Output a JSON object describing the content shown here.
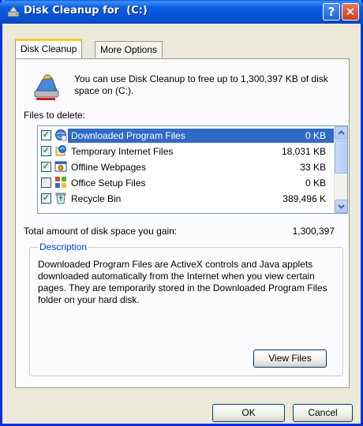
{
  "window": {
    "title": "Disk Cleanup for  (C:)",
    "help_glyph": "?",
    "close_glyph": "✕",
    "titlebar_color": "#0a5fe3"
  },
  "tabs": [
    {
      "label": "Disk Cleanup",
      "active": true
    },
    {
      "label": "More Options",
      "active": false
    }
  ],
  "intro": {
    "icon": "disk-cleanup-icon",
    "text": "You can use Disk Cleanup to free up to 1,300,397 KB of disk space on  (C:)."
  },
  "files_label": "Files to delete:",
  "files": [
    {
      "label": "Downloaded Program Files",
      "size": "0 KB",
      "checked": true,
      "selected": true,
      "icon": "globe-icon"
    },
    {
      "label": "Temporary Internet Files",
      "size": "18,031 KB",
      "checked": true,
      "selected": false,
      "icon": "internet-files-icon"
    },
    {
      "label": "Offline Webpages",
      "size": "33 KB",
      "checked": true,
      "selected": false,
      "icon": "offline-pages-icon"
    },
    {
      "label": "Office Setup Files",
      "size": "0 KB",
      "checked": false,
      "selected": false,
      "icon": "office-setup-icon"
    },
    {
      "label": "Recycle Bin",
      "size": "389,496 K",
      "checked": true,
      "selected": false,
      "icon": "recycle-bin-icon"
    }
  ],
  "total": {
    "label": "Total amount of disk space you gain:",
    "value": "1,300,397"
  },
  "description": {
    "legend": "Description",
    "text": "Downloaded Program Files are ActiveX controls and Java applets downloaded automatically from the Internet when you view certain pages. They are temporarily stored in the Downloaded Program Files folder on your hard disk."
  },
  "buttons": {
    "view_files": "View Files",
    "ok": "OK",
    "cancel": "Cancel"
  },
  "colors": {
    "selection": "#316ac5",
    "legend": "#0046d5",
    "check": "#21a121"
  }
}
